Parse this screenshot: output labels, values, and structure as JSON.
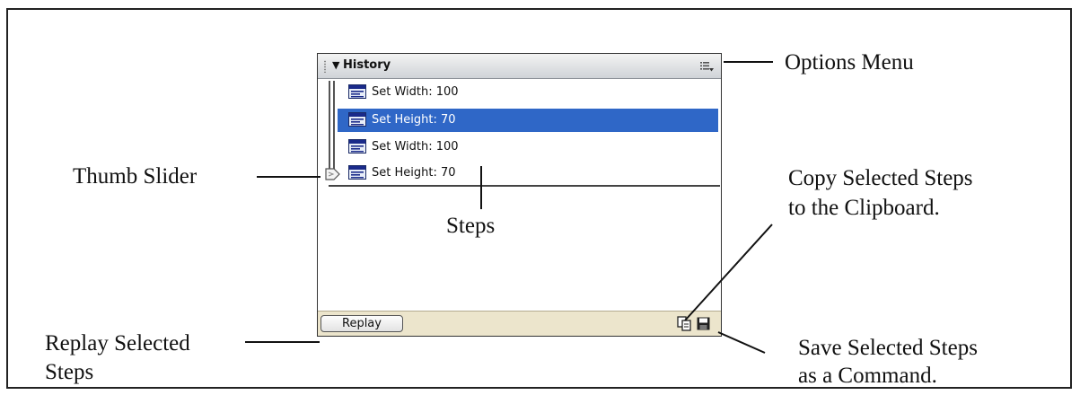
{
  "panel": {
    "title": "History",
    "steps": [
      {
        "label": "Set Width: 100",
        "selected": false
      },
      {
        "label": "Set Height: 70",
        "selected": true
      },
      {
        "label": "Set Width: 100",
        "selected": false
      },
      {
        "label": "Set Height: 70",
        "selected": false
      }
    ],
    "replay_label": "Replay",
    "colors": {
      "selection": "#2f67c7",
      "footer": "#ece5cc",
      "header": "#cfd3d8"
    }
  },
  "callouts": {
    "options_menu": "Options Menu",
    "thumb_slider": "Thumb Slider",
    "steps": "Steps",
    "copy_line1": "Copy Selected Steps",
    "copy_line2": "to the Clipboard.",
    "replay_line1": "Replay Selected",
    "replay_line2": "Steps",
    "save_line1": "Save Selected Steps",
    "save_line2": "as a Command."
  },
  "icons": [
    "grip-icon",
    "collapse-arrow-icon",
    "options-menu-icon",
    "step-icon",
    "slider-thumb-icon",
    "copy-icon",
    "save-icon"
  ]
}
